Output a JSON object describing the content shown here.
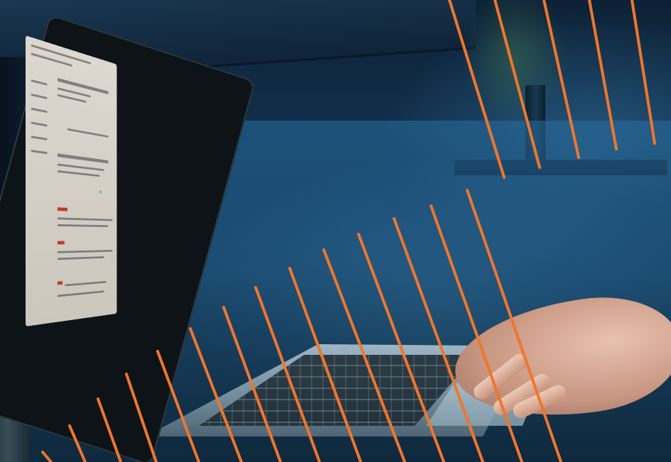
{
  "scene": {
    "description_free": true,
    "accent_color": "#f0762b",
    "background_color": "#123554",
    "screen_color": "#dcd8cf",
    "skin_color": "#e0b7a2"
  },
  "streaks": {
    "color": "#f0762b",
    "count": 20
  }
}
